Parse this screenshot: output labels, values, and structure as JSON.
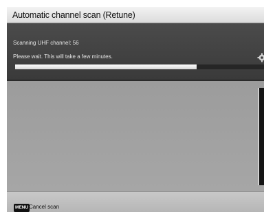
{
  "window": {
    "title": "Automatic channel scan (Retune)"
  },
  "scan": {
    "status_text": "Scanning UHF channel: 56",
    "message": "Please wait. This will take a few minutes.",
    "progress_fraction": 0.73
  },
  "footer": {
    "key_label": "MENU",
    "action_label": "Cancel scan"
  },
  "icons": {
    "busy": "gear-icon"
  },
  "colors": {
    "panel": "#444444",
    "progress_fill": "#f2f2f2",
    "progress_track": "#262626"
  }
}
